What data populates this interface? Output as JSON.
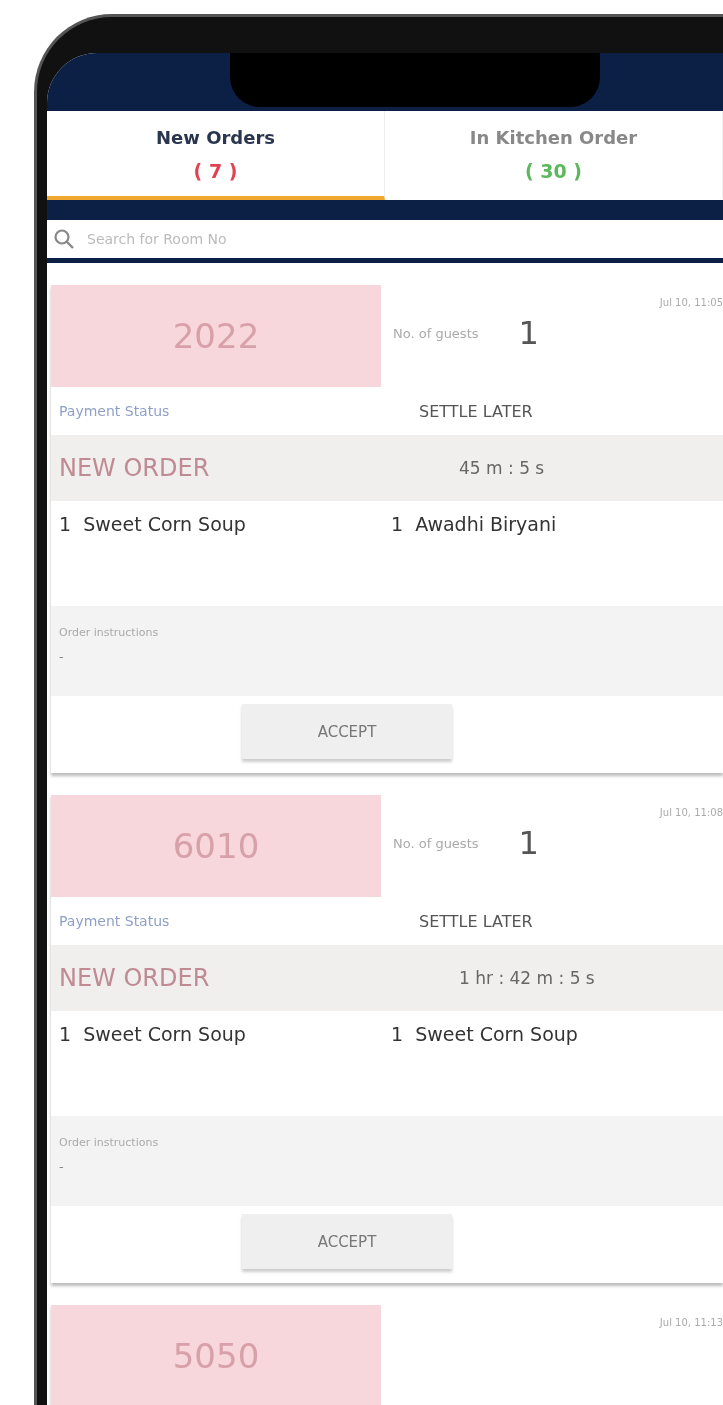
{
  "tabs": [
    {
      "label": "New Orders",
      "count": "( 7 )",
      "color": "#e0424f",
      "selected": true
    },
    {
      "label": "In Kitchen Order",
      "count": "( 30 )",
      "color": "#5cb85c",
      "selected": false
    }
  ],
  "search": {
    "placeholder": "Search for Room No"
  },
  "orders": [
    {
      "room": "2022",
      "date": "Jul 10, 11:05",
      "guests_label": "No. of guests",
      "guests": "1",
      "payment_label": "Payment Status",
      "payment_status": "SETTLE LATER",
      "status": "NEW ORDER",
      "elapsed": "45 m : 5 s",
      "items": [
        {
          "qty": "1",
          "name": "Sweet Corn Soup"
        },
        {
          "qty": "1",
          "name": "Awadhi Biryani"
        }
      ],
      "instructions_label": "Order instructions",
      "instructions": "-",
      "button": "ACCEPT"
    },
    {
      "room": "6010",
      "date": "Jul 10, 11:08",
      "guests_label": "No. of guests",
      "guests": "1",
      "payment_label": "Payment Status",
      "payment_status": "SETTLE LATER",
      "status": "NEW ORDER",
      "elapsed": "1 hr : 42 m : 5 s",
      "items": [
        {
          "qty": "1",
          "name": "Sweet Corn Soup"
        },
        {
          "qty": "1",
          "name": "Sweet Corn Soup"
        }
      ],
      "instructions_label": "Order instructions",
      "instructions": "-",
      "button": "ACCEPT"
    },
    {
      "room": "5050",
      "date": "Jul 10, 11:13"
    }
  ]
}
